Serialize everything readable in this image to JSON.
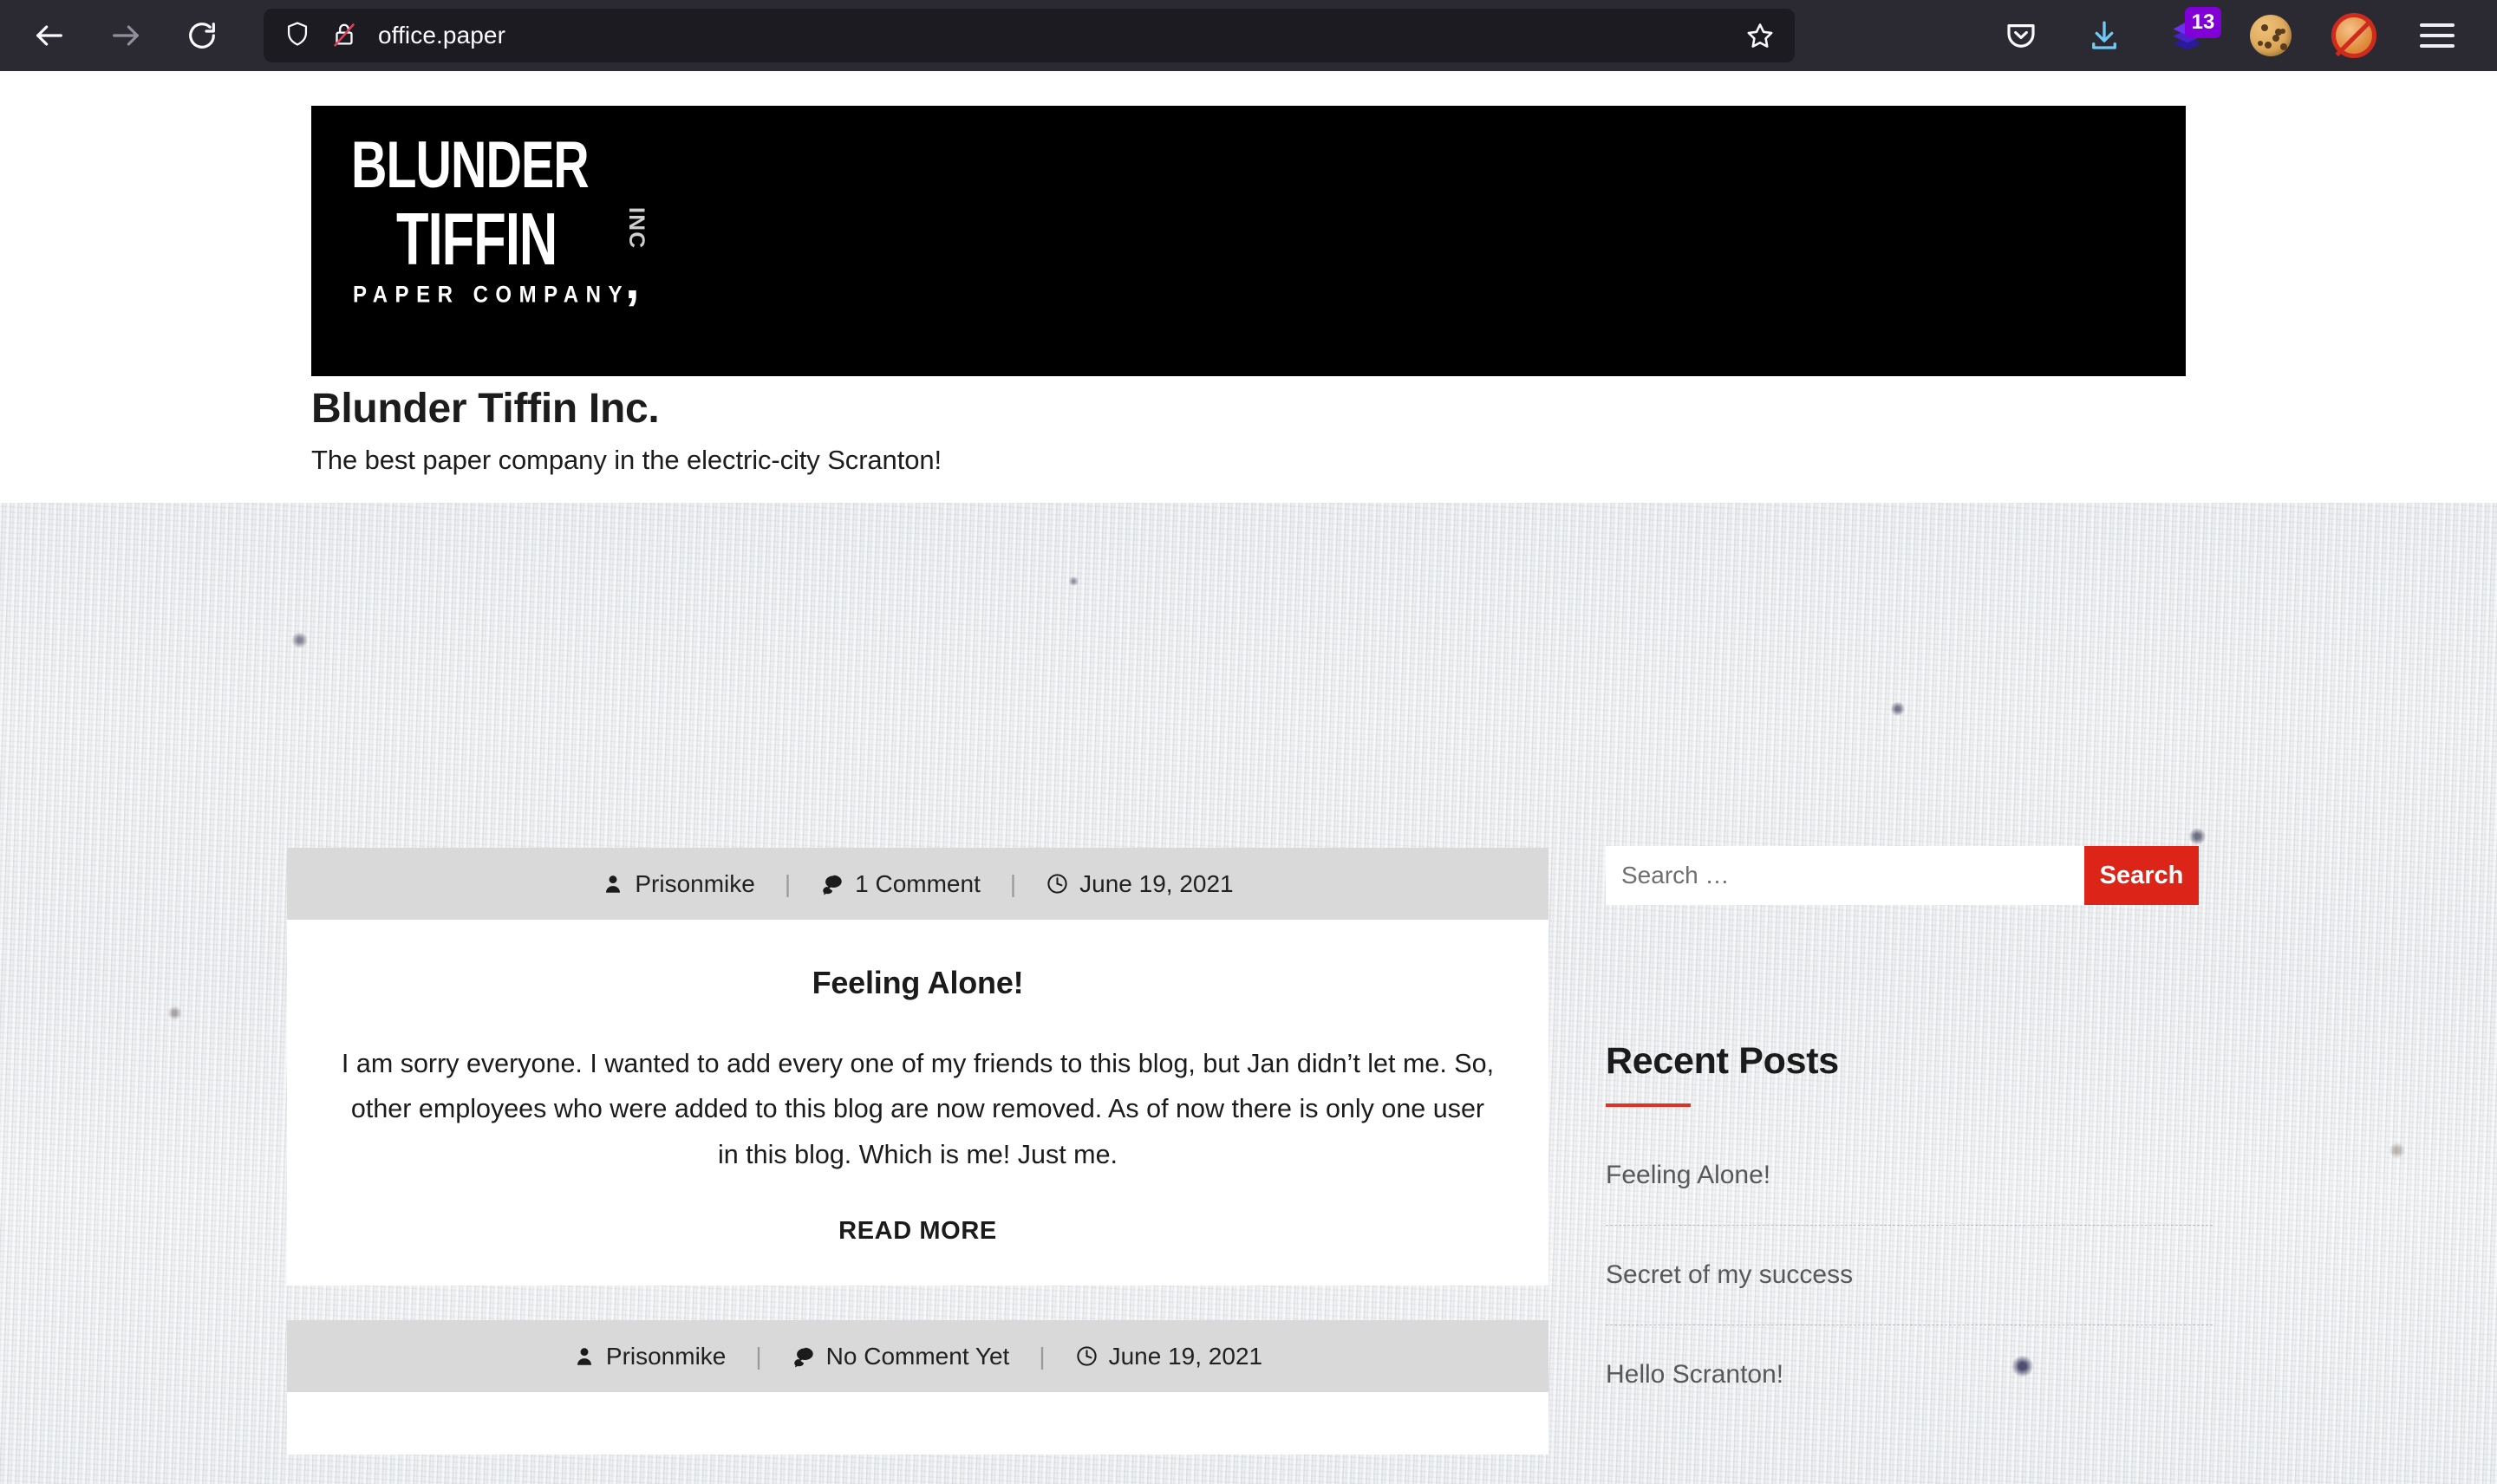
{
  "browser": {
    "nav": {
      "back_label": "Back",
      "forward_label": "Forward",
      "reload_label": "Reload"
    },
    "url": "office.paper",
    "url_icons": [
      "shield-icon",
      "padlock-crossed-icon"
    ],
    "bookmark_label": "Bookmark this page",
    "toolbar_icons": [
      {
        "name": "pocket-icon",
        "label": "Save to Pocket"
      },
      {
        "name": "download-icon",
        "label": "Downloads"
      },
      {
        "name": "layers-extension-icon",
        "label": "Extension",
        "badge": "13"
      },
      {
        "name": "cookie-icon",
        "label": "Cookie manager"
      },
      {
        "name": "fox-blocked-icon",
        "label": "Tracker blocked"
      },
      {
        "name": "hamburger-menu-icon",
        "label": "Open application menu"
      }
    ]
  },
  "site": {
    "logo": {
      "line1": "BLUNDER",
      "line2": "TIFFIN",
      "inc": "INC",
      "comma": ",",
      "line3": "PAPER COMPANY"
    },
    "title": "Blunder Tiffin Inc.",
    "tagline": "The best paper company in the electric-city Scranton!"
  },
  "posts": [
    {
      "author": "Prisonmike",
      "comments": "1 Comment",
      "date": "June 19, 2021",
      "title": "Feeling Alone!",
      "body": "I am sorry everyone. I wanted to add every one of my friends to this blog, but Jan didn’t let me. So, other employees who were added to this blog are now removed. As of now there is only one user in this blog. Which is me! Just me.",
      "read_more": "READ MORE"
    },
    {
      "author": "Prisonmike",
      "comments": "No Comment Yet",
      "date": "June 19, 2021"
    }
  ],
  "sidebar": {
    "search": {
      "placeholder": "Search …",
      "value": "",
      "button_label": "Search"
    },
    "recent_posts": {
      "heading": "Recent Posts",
      "items": [
        {
          "label": "Feeling Alone!"
        },
        {
          "label": "Secret of my success"
        },
        {
          "label": "Hello Scranton!"
        }
      ]
    }
  },
  "colors": {
    "accent_red": "#dc2518",
    "chrome_bg": "#2b2a33",
    "urlbar_bg": "#1c1b22",
    "meta_bar_bg": "#d9d9d9",
    "badge_purple": "#8000d7"
  }
}
